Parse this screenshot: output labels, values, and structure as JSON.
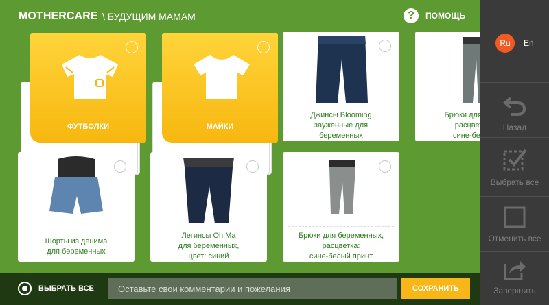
{
  "header": {
    "brand": "MOTHERCARE",
    "breadcrumb": "\\ БУДУЩИМ МАМАМ",
    "help_label": "ПОМОЩЬ"
  },
  "categories": [
    {
      "label": "ФУТБОЛКИ",
      "icon": "tshirt-icon"
    },
    {
      "label": "МАЙКИ",
      "icon": "tank-top-icon"
    }
  ],
  "products": [
    {
      "caption": "Джинсы Blooming\nзауженные для\nбеременных"
    },
    {
      "caption": "Брюки для бер...\nрасцветк...\nсине-белый"
    },
    {
      "caption": "Шорты из денима\nдля беременных"
    },
    {
      "caption": "Легинсы Oh Ma\nдля беременных,\nцвет: синий"
    },
    {
      "caption": "Брюки для беременных,\nрасцветка:\nсине-белый принт"
    }
  ],
  "bottom": {
    "select_all_label": "ВЫБРАТЬ ВСЕ",
    "comment_placeholder": "Оставьте свои комментарии и пожелания",
    "save_label": "СОХРАНИТЬ"
  },
  "panel": {
    "lang_ru": "Ru",
    "lang_en": "En",
    "back_label": "Назад",
    "select_all_label": "Выбрать все",
    "deselect_all_label": "Отменить все",
    "finish_label": "Завершить"
  },
  "colors": {
    "background": "#5d9a32",
    "accent_yellow": "#f8b716",
    "caption_green": "#2e7d1e",
    "panel": "#3a3a3a",
    "lang_active": "#f15a22"
  }
}
